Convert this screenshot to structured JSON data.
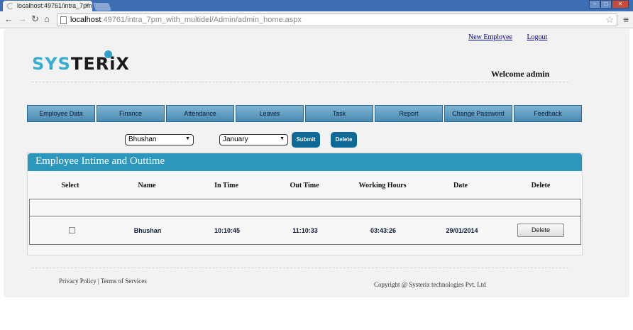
{
  "browser": {
    "tab_title": "localhost:49761/intra_7pm",
    "url_host": "localhost",
    "url_rest": ":49761/intra_7pm_with_multidel/Admin/admin_home.aspx"
  },
  "header": {
    "links": [
      "New Employee",
      "Logout"
    ],
    "logo_part1": "SYS",
    "logo_part2": "TERiX",
    "welcome": "Welcome admin"
  },
  "nav": {
    "items": [
      "Employee  Data",
      "Finance",
      "Attendance",
      "Leaves",
      "Task",
      "Report",
      "Change Password",
      "Feedback"
    ]
  },
  "filters": {
    "employee": "Bhushan",
    "month": "January",
    "submit_label": "Submit",
    "delete_label": "Delete"
  },
  "panel": {
    "title": "Employee Intime and Outtime",
    "columns": [
      "Select",
      "Name",
      "In Time",
      "Out Time",
      "Working Hours",
      "Date",
      "Delete"
    ],
    "rows": [
      {
        "name": "Bhushan",
        "in_time": "10:10:45",
        "out_time": "11:10:33",
        "working_hours": "03:43:26",
        "date": "29/01/2014",
        "delete_label": "Delete"
      }
    ]
  },
  "footer": {
    "privacy": "Privacy Policy",
    "terms": "Terms of Services",
    "copyright": "Copyright @ Systerix technologies Pvt. Ltd"
  }
}
